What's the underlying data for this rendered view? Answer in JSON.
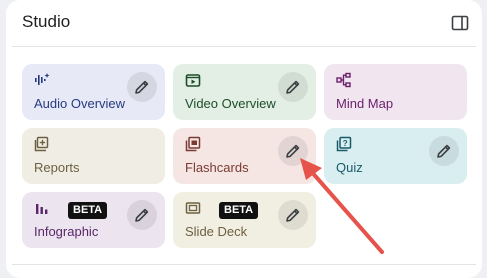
{
  "studio": {
    "title": "Studio",
    "toggle_icon": "panel-toggle-icon"
  },
  "tiles": [
    {
      "label": "Audio Overview",
      "icon": "audio-waveform-icon",
      "editable": true
    },
    {
      "label": "Video Overview",
      "icon": "video-icon",
      "editable": true
    },
    {
      "label": "Mind Map",
      "icon": "mind-map-icon",
      "editable": false
    },
    {
      "label": "Reports",
      "icon": "reports-icon",
      "editable": false
    },
    {
      "label": "Flashcards",
      "icon": "flashcards-icon",
      "editable": true
    },
    {
      "label": "Quiz",
      "icon": "quiz-icon",
      "editable": true
    },
    {
      "label": "Infographic",
      "icon": "infographic-icon",
      "badge": "BETA",
      "editable": true
    },
    {
      "label": "Slide Deck",
      "icon": "slide-deck-icon",
      "badge": "BETA",
      "editable": true
    }
  ],
  "annotation": {
    "arrow_color": "#e5534b",
    "points_to": "Flashcards edit button"
  }
}
